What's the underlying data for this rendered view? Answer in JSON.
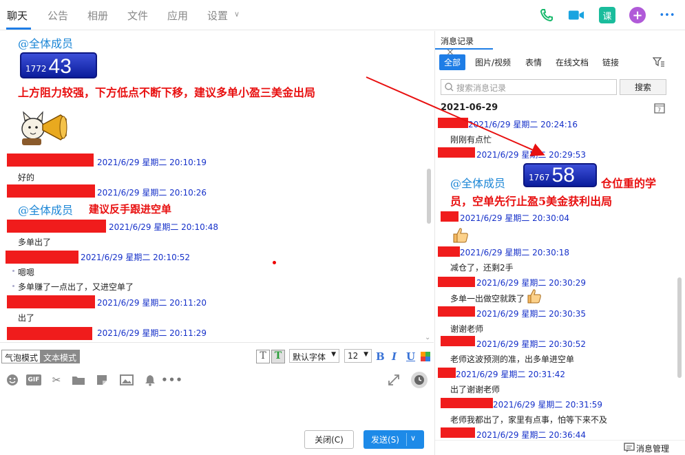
{
  "tabs": [
    "聊天",
    "公告",
    "相册",
    "文件",
    "应用",
    "设置"
  ],
  "tab_settings_chevron": "∨",
  "top_icons": {
    "phone": {
      "icon": "phone-icon",
      "color": "#17b86b"
    },
    "video": {
      "icon": "video-icon",
      "color": "#1aa4e0"
    },
    "course": {
      "icon": "course-icon",
      "label": "课",
      "color": "#1abc9c"
    },
    "add": {
      "icon": "plus-icon",
      "label": "+",
      "color": "#b05ad8"
    },
    "more": {
      "icon": "more-icon",
      "label": "•••",
      "color": "#1e7de6"
    }
  },
  "chat": {
    "mention1": "@全体成员",
    "price1": {
      "small": "1772",
      "big": "43"
    },
    "analysis1": "上方阻力较强，下方低点不断下移，建议多单小盈三美金出局",
    "row1_time": "2021/6/29 星期二 20:10:19",
    "row1_msg": "好的",
    "row2_time": "2021/6/29 星期二 20:10:26",
    "mention2": "@全体成员",
    "analysis2": "建议反手跟进空单",
    "row3_time": "2021/6/29 星期二 20:10:48",
    "row3_msg": "多单出了",
    "row4_time": "2021/6/29 星期二 20:10:52",
    "row4_msg1": "嗯嗯",
    "row4_msg2": "多单赚了一点出了，又进空单了",
    "row5_time": "2021/6/29 星期二 20:11:20",
    "row5_msg": "出了",
    "row6_time": "2021/6/29 星期二 20:11:29"
  },
  "editor": {
    "bubble_mode": "气泡模式",
    "text_mode": "文本模式",
    "font": "默认字体",
    "font_size": "12",
    "bold": "B",
    "italic": "I",
    "underline": "U",
    "close": "关闭(C)",
    "send": "发送(S)",
    "tools": [
      "smile-icon",
      "gif-icon",
      "scissors-icon",
      "folder-icon",
      "sticker-icon",
      "image-icon",
      "bell-icon",
      "ellipsis-icon"
    ],
    "gif_label": "GIF"
  },
  "history": {
    "tab_label": "消息记录",
    "tab_close": "×",
    "filters": [
      "全部",
      "图片/视频",
      "表情",
      "在线文档",
      "链接"
    ],
    "search_placeholder": "搜索消息记录",
    "search_btn": "搜索",
    "date": "2021-06-29",
    "items": [
      {
        "time": "2021/6/29 星期二 20:24:16",
        "msg": "刚刚有点忙"
      },
      {
        "time": "2021/6/29 星期二 20:29:53",
        "msg": ""
      },
      {
        "time": "2021/6/29 星期二 20:30:04",
        "msg": ""
      },
      {
        "time": "2021/6/29 星期二 20:30:18",
        "msg": "减仓了，还剩2手"
      },
      {
        "time": "2021/6/29 星期二 20:30:29",
        "msg": "多单一出做空就跌了"
      },
      {
        "time": "2021/6/29 星期二 20:30:35",
        "msg": "谢谢老师"
      },
      {
        "time": "2021/6/29 星期二 20:30:52",
        "msg": "老师这波预测的准，出多单进空单"
      },
      {
        "time": "2021/6/29 星期二 20:31:42",
        "msg": "出了谢谢老师"
      },
      {
        "time": "2021/6/29 星期二 20:31:59",
        "msg": "老师我都出了，家里有点事，怕等下来不及"
      },
      {
        "time": "2021/6/29 星期二 20:36:44",
        "msg": ""
      }
    ],
    "mention": "@全体成员",
    "price": {
      "small": "1767",
      "big": "58"
    },
    "analysis_line1": "仓位重的学",
    "analysis_line2": "员，空单先行止盈5美金获利出局",
    "manage": "消息管理"
  }
}
